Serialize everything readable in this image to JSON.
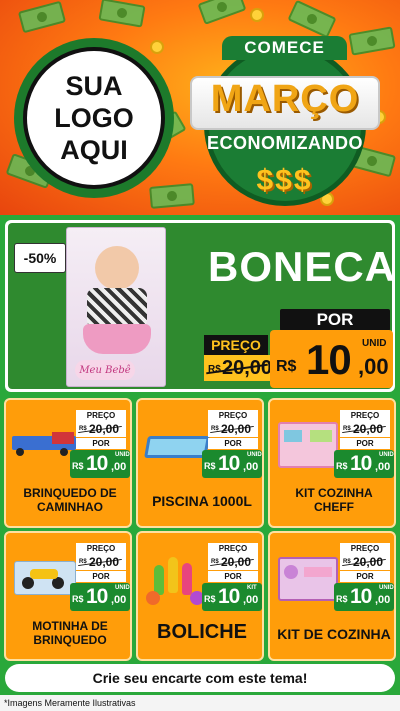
{
  "header": {
    "logo_line1": "SUA",
    "logo_line2": "LOGO",
    "logo_line3": "AQUI",
    "campaign_top": "COMECE",
    "campaign_main": "MARÇO",
    "campaign_sub": "ECONOMIZANDO",
    "campaign_symbols": "$$$"
  },
  "featured": {
    "discount": "-50%",
    "title": "BONECA",
    "product_brand": "Meu Bebê",
    "old_label": "PREÇO",
    "old_currency": "R$",
    "old_value": "20,00",
    "new_label": "POR",
    "currency": "R$",
    "price_int": "10",
    "price_dec": ",00",
    "unit": "UNID"
  },
  "products": [
    {
      "name": "BRINQUEDO DE CAMINHAO",
      "old_label": "PREÇO",
      "old_currency": "R$",
      "old_value": "20,00",
      "new_label": "POR",
      "currency": "R$",
      "price_int": "10",
      "price_dec": ",00",
      "unit": "UNID"
    },
    {
      "name": "PISCINA 1000L",
      "old_label": "PREÇO",
      "old_currency": "R$",
      "old_value": "20,00",
      "new_label": "POR",
      "currency": "R$",
      "price_int": "10",
      "price_dec": ",00",
      "unit": "UNID"
    },
    {
      "name": "KIT COZINHA CHEFF",
      "old_label": "PREÇO",
      "old_currency": "R$",
      "old_value": "20,00",
      "new_label": "POR",
      "currency": "R$",
      "price_int": "10",
      "price_dec": ",00",
      "unit": "UNID"
    },
    {
      "name": "MOTINHA DE BRINQUEDO",
      "old_label": "PREÇO",
      "old_currency": "R$",
      "old_value": "20,00",
      "new_label": "POR",
      "currency": "R$",
      "price_int": "10",
      "price_dec": ",00",
      "unit": "UNID"
    },
    {
      "name": "BOLICHE",
      "old_label": "PREÇO",
      "old_currency": "R$",
      "old_value": "20,00",
      "new_label": "POR",
      "currency": "R$",
      "price_int": "10",
      "price_dec": ",00",
      "unit": "KIT"
    },
    {
      "name": "KIT DE COZINHA",
      "old_label": "PREÇO",
      "old_currency": "R$",
      "old_value": "20,00",
      "new_label": "POR",
      "currency": "R$",
      "price_int": "10",
      "price_dec": ",00",
      "unit": "UNID"
    }
  ],
  "banner": "Crie seu encarte com este tema!",
  "footer": "*Imagens Meramente Ilustrativas",
  "colors": {
    "header_orange": "#ff7a12",
    "green_bg": "#2aa83a",
    "card_orange": "#ff9d0a",
    "price_green": "#1b8a2e",
    "featured_green": "#2f8a2f"
  }
}
